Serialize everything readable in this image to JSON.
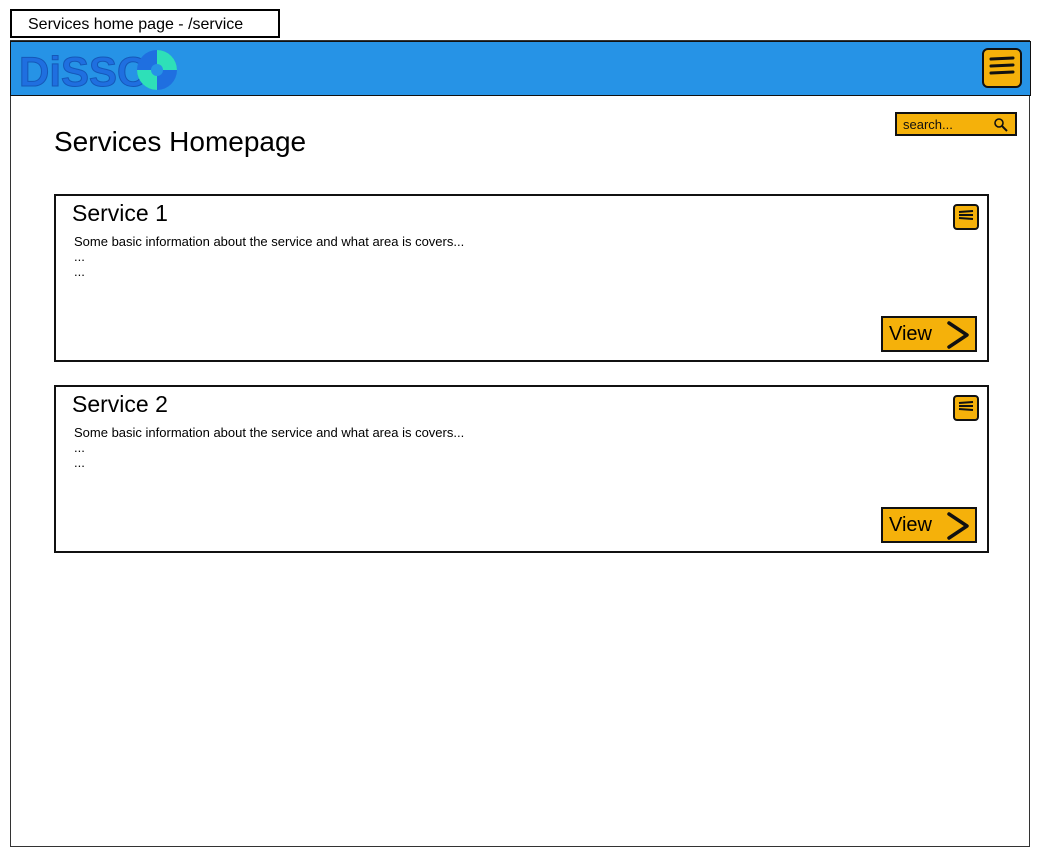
{
  "page_tab": {
    "label": "Services home page - /service"
  },
  "header": {
    "logo_text": "DiSCO"
  },
  "main": {
    "title": "Services Homepage",
    "search": {
      "placeholder": "search..."
    }
  },
  "services": [
    {
      "title": "Service 1",
      "description": "Some basic information about the service and what area is covers...\n...\n...",
      "view_label": "View"
    },
    {
      "title": "Service 2",
      "description": "Some basic information about the service and what area is covers...\n...\n...",
      "view_label": "View"
    }
  ],
  "colors": {
    "header_blue": "#2693e6",
    "accent_orange": "#f5b10a",
    "logo_blue": "#1f6fe0",
    "logo_teal": "#2ee0b8"
  },
  "icons": {
    "menu": "hamburger-icon",
    "search": "magnifier-icon",
    "view": "chevron-right-icon"
  }
}
